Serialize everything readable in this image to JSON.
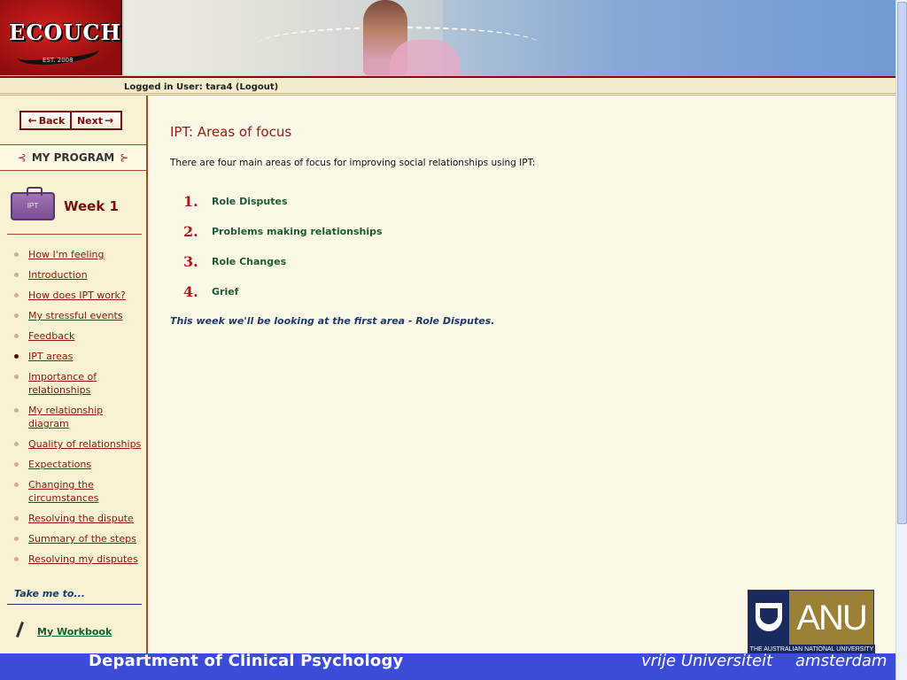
{
  "header": {
    "logo_text": "ECOUCH",
    "logo_est": "EST. 2008",
    "login_text": "Logged in User: tara4 (Logout)"
  },
  "sidebar": {
    "back_label": "Back",
    "next_label": "Next",
    "program_label": "MY PROGRAM",
    "case_label": "IPT",
    "week_label": "Week 1",
    "menu_items": [
      {
        "label": "How I'm feeling",
        "active": false
      },
      {
        "label": "Introduction",
        "active": false
      },
      {
        "label": "How does IPT work?",
        "active": false
      },
      {
        "label": "My stressful events",
        "active": false
      },
      {
        "label": "Feedback",
        "active": false
      },
      {
        "label": "IPT areas",
        "active": true
      },
      {
        "label": "Importance of relationships",
        "active": false
      },
      {
        "label": "My relationship diagram",
        "active": false
      },
      {
        "label": "Quality of relationships",
        "active": false
      },
      {
        "label": "Expectations",
        "active": false
      },
      {
        "label": "Changing the circumstances",
        "active": false
      },
      {
        "label": "Resolving the dispute",
        "active": false
      },
      {
        "label": "Summary of the steps",
        "active": false
      },
      {
        "label": "Resolving my disputes",
        "active": false
      }
    ],
    "take_me_label": "Take me to...",
    "workbook_label": "My Workbook"
  },
  "main": {
    "title": "IPT: Areas of focus",
    "intro": "There are four main areas of focus for improving social relationships using IPT:",
    "focus_items": [
      {
        "num": "1.",
        "text": "Role Disputes"
      },
      {
        "num": "2.",
        "text": "Problems making relationships"
      },
      {
        "num": "3.",
        "text": "Role Changes"
      },
      {
        "num": "4.",
        "text": "Grief"
      }
    ],
    "week_note": "This week we'll be looking at the first area - Role Disputes."
  },
  "anu": {
    "text": "ANU",
    "subtitle": "THE AUSTRALIAN NATIONAL UNIVERSITY"
  },
  "footer": {
    "left": "Department of Clinical Psychology",
    "right_a": "vrije Universiteit",
    "right_b": "amsterdam"
  },
  "colors": {
    "accent": "#a11a0e",
    "green_link": "#1d5a33",
    "footer_blue": "#3c4cd8"
  }
}
